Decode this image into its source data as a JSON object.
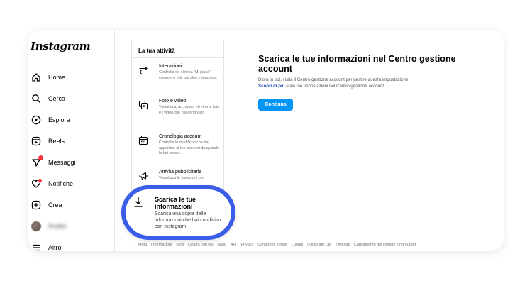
{
  "app": {
    "logo": "Instagram"
  },
  "sidebar": {
    "items": [
      {
        "label": "Home",
        "icon": "home-icon"
      },
      {
        "label": "Cerca",
        "icon": "search-icon"
      },
      {
        "label": "Esplora",
        "icon": "compass-icon"
      },
      {
        "label": "Reels",
        "icon": "reels-icon"
      },
      {
        "label": "Messaggi",
        "icon": "messenger-icon"
      },
      {
        "label": "Notifiche",
        "icon": "heart-icon"
      },
      {
        "label": "Crea",
        "icon": "plus-square-icon"
      },
      {
        "label": "Profilo",
        "icon": "avatar"
      },
      {
        "label": "Altro",
        "icon": "menu-icon"
      }
    ]
  },
  "activity_menu": {
    "title": "La tua attività",
    "items": [
      {
        "title": "Interazioni",
        "desc": "Controlla ed elimina \"Mi piace\", commenti e le tue altre interazioni.",
        "icon": "interactions-icon"
      },
      {
        "title": "Foto e video",
        "desc": "Visualizza, archivia o elimina le foto e i video che hai condiviso.",
        "icon": "photos-icon"
      },
      {
        "title": "Cronologia account",
        "desc": "Controlla le modifiche che hai apportato al tuo account da quando lo hai creato.",
        "icon": "calendar-icon"
      },
      {
        "title": "Attività pubblicitaria",
        "desc": "Visualizza le inserzioni con",
        "icon": "megaphone-icon"
      }
    ],
    "highlighted": {
      "title": "Scarica le tue informazioni",
      "desc": "Scarica una copia delle informazioni che hai condiviso con Instagram.",
      "icon": "download-icon"
    }
  },
  "content": {
    "title": "Scarica le tue informazioni nel Centro gestione account",
    "text_1": "D'ora in poi, visita il Centro gestione account per gestire questa impostazione.",
    "link": "Scopri di più",
    "text_2": "sulle tue impostazioni nel Centro gestione account.",
    "button": "Continua"
  },
  "footer": {
    "links": [
      "Meta",
      "Informazioni",
      "Blog",
      "Lavora con noi",
      "Aiuto",
      "API",
      "Privacy",
      "Condizioni e note",
      "Luoghi",
      "Instagram Lite",
      "Threads",
      "Caricamento dei contatti e non-utenti"
    ]
  },
  "colors": {
    "accent": "#0095f6",
    "highlight_ring": "#3a5de8",
    "notification": "#ff3040"
  }
}
